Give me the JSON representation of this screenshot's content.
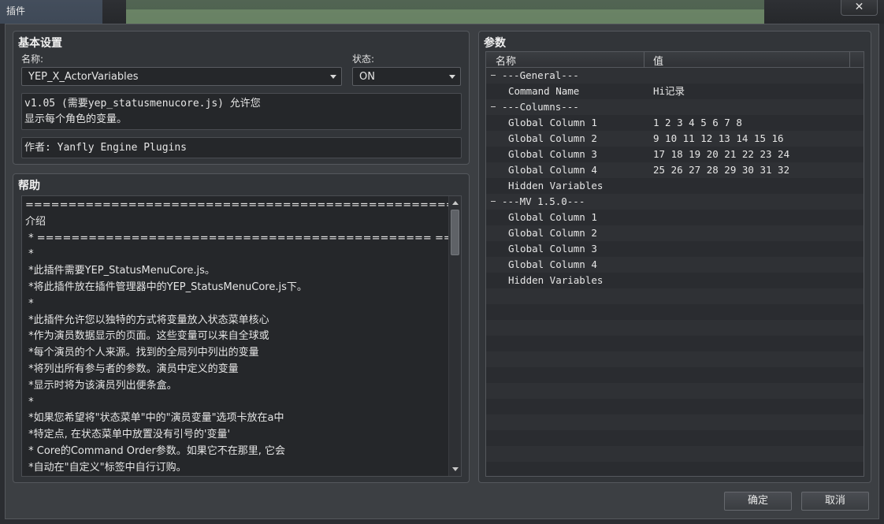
{
  "window": {
    "title": "插件",
    "close_glyph": "✕"
  },
  "basic": {
    "title": "基本设置",
    "name_label": "名称:",
    "name_value": "YEP_X_ActorVariables",
    "status_label": "状态:",
    "status_value": "ON",
    "description_lines": [
      "v1.05 (需要yep_statusmenucore.js) 允许您",
      "显示每个角色的变量。"
    ],
    "author": "作者: Yanfly Engine Plugins"
  },
  "help": {
    "title": "帮助",
    "lines": [
      "==============================================================================",
      "介绍",
      " * ============================================== ====================================",
      " *",
      " *此插件需要YEP_StatusMenuCore.js。",
      " *将此插件放在插件管理器中的YEP_StatusMenuCore.js下。",
      " *",
      " *此插件允许您以独特的方式将变量放入状态菜单核心",
      " *作为演员数据显示的页面。这些变量可以来自全球或",
      " *每个演员的个人来源。找到的全局列中列出的变量",
      " *将列出所有参与者的参数。演员中定义的变量",
      " *显示时将为该演员列出便条盒。",
      " *",
      " *如果您希望将\"状态菜单\"中的\"演员变量\"选项卡放在a中",
      " *特定点, 在状态菜单中放置没有引号的'变量'",
      " * Core的Command Order参数。如果它不在那里, 它会",
      " *自动在\"自定义\"标签中自行订购。"
    ]
  },
  "params": {
    "title": "参数",
    "col_name": "名称",
    "col_value": "值",
    "rows": [
      {
        "name": "---General---",
        "value": "",
        "group": true
      },
      {
        "name": "Command Name",
        "value": "Hi记录",
        "group": false
      },
      {
        "name": "---Columns---",
        "value": "",
        "group": true
      },
      {
        "name": "Global Column 1",
        "value": "1 2 3 4 5 6 7 8",
        "group": false
      },
      {
        "name": "Global Column 2",
        "value": "9 10 11 12 13 14 15 16",
        "group": false
      },
      {
        "name": "Global Column 3",
        "value": "17 18 19 20 21 22 23 24",
        "group": false
      },
      {
        "name": "Global Column 4",
        "value": "25 26 27 28 29 30 31 32",
        "group": false
      },
      {
        "name": "Hidden Variables",
        "value": "",
        "group": false
      },
      {
        "name": "---MV 1.5.0---",
        "value": "",
        "group": true
      },
      {
        "name": "Global Column 1",
        "value": "",
        "group": false
      },
      {
        "name": "Global Column 2",
        "value": "",
        "group": false
      },
      {
        "name": "Global Column 3",
        "value": "",
        "group": false
      },
      {
        "name": "Global Column 4",
        "value": "",
        "group": false
      },
      {
        "name": "Hidden Variables",
        "value": "",
        "group": false
      }
    ]
  },
  "buttons": {
    "ok": "确定",
    "cancel": "取消"
  },
  "colors": {
    "background": "#2b2d31",
    "panel": "#323539",
    "field": "#25272a",
    "text": "#e6e6e6"
  }
}
